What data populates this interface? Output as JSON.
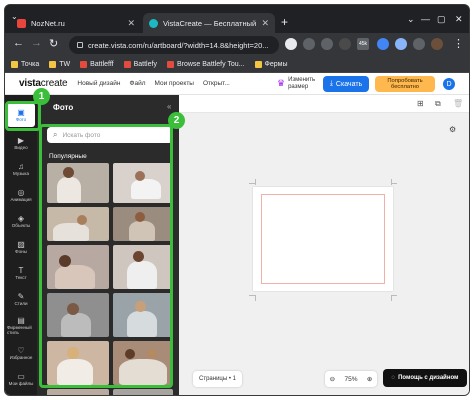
{
  "browser": {
    "tabs": [
      {
        "title": "NozNet.ru",
        "active": false
      },
      {
        "title": "VistaCreate — Бесплатный инст",
        "active": true
      }
    ],
    "new_tab": "+",
    "window_controls": {
      "collapse": "⌄",
      "minimize": "—",
      "maximize": "▢",
      "close": "✕"
    },
    "url": "create.vista.com/ru/artboard/?width=14.8&height=20...",
    "bookmarks": [
      "Точка",
      "TW",
      "Battlefff",
      "Battlefy",
      "Browse Battlefy Tou...",
      "Фермы"
    ],
    "extension_badge": "45k"
  },
  "app": {
    "logo_main": "vista",
    "logo_suffix": "create",
    "nav": [
      "Новый дизайн",
      "Файл",
      "Мои проекты",
      "Открыт..."
    ],
    "resize_line1": "Изменить",
    "resize_line2": "размер",
    "create_button": "Скачать",
    "try_line1": "Попробовать",
    "try_line2": "бесплатно",
    "avatar": "D"
  },
  "rail": [
    {
      "label": "Фото",
      "glyph": "▣",
      "active": true
    },
    {
      "label": "Видео",
      "glyph": "▶",
      "active": false
    },
    {
      "label": "Музыка",
      "glyph": "♫",
      "active": false
    },
    {
      "label": "Анимация",
      "glyph": "◎",
      "active": false
    },
    {
      "label": "Объекты",
      "glyph": "◈",
      "active": false
    },
    {
      "label": "Фоны",
      "glyph": "▨",
      "active": false
    },
    {
      "label": "Текст",
      "glyph": "T",
      "active": false
    },
    {
      "label": "Стили",
      "glyph": "✎",
      "active": false
    },
    {
      "label": "Фирменный стиль",
      "glyph": "▤",
      "active": false
    },
    {
      "label": "Избранное",
      "glyph": "♡",
      "active": false
    },
    {
      "label": "Мои файлы",
      "glyph": "▭",
      "active": false
    }
  ],
  "panel": {
    "title": "Фото",
    "search_placeholder": "Искать фото",
    "section": "Популярные",
    "collapse": "«"
  },
  "callouts": [
    "1",
    "2"
  ],
  "canvas": {
    "pages_label": "Страницы • 1",
    "zoom_level": "75%",
    "help_label": "Помощь с дизайном"
  },
  "colors": {
    "accent": "#1a73e8",
    "callout": "#3bbf3a",
    "try_button": "#ffb84d",
    "panel": "#2b2b2b",
    "rail": "#1e1e1e"
  }
}
